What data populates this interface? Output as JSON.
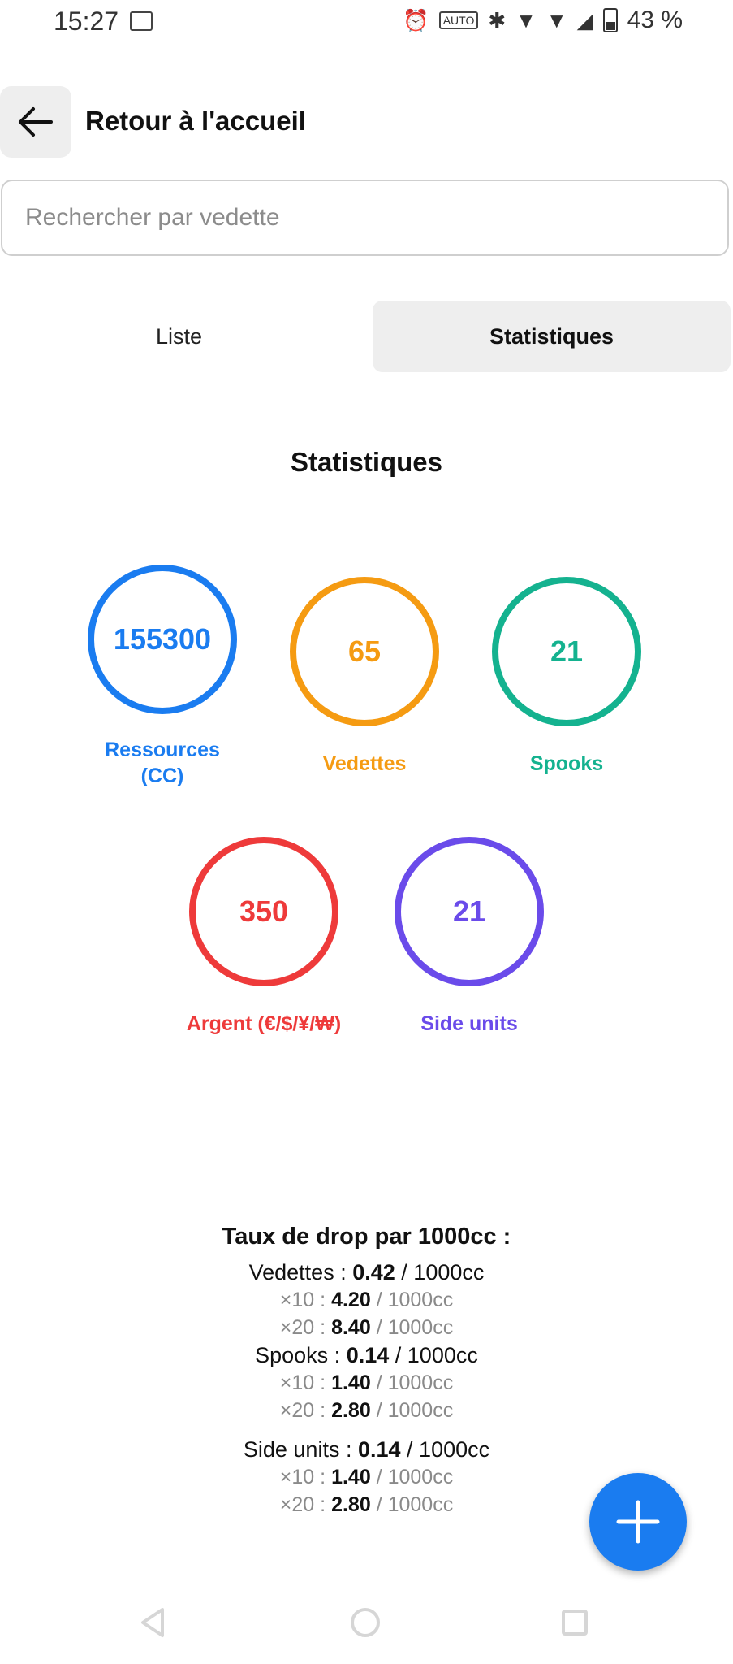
{
  "status_bar": {
    "time": "15:27",
    "battery": "43 %"
  },
  "header": {
    "title": "Retour à l'accueil"
  },
  "search": {
    "placeholder": "Rechercher par vedette"
  },
  "tabs": [
    {
      "label": "Liste",
      "active": false
    },
    {
      "label": "Statistiques",
      "active": true
    }
  ],
  "stats": {
    "title": "Statistiques",
    "items": [
      {
        "value": "155300",
        "label": "Ressources (CC)",
        "color": "#1a7cf0"
      },
      {
        "value": "65",
        "label": "Vedettes",
        "color": "#f59b12"
      },
      {
        "value": "21",
        "label": "Spooks",
        "color": "#14b28f"
      },
      {
        "value": "350",
        "label": "Argent (€/$/¥/₩)",
        "color": "#ee3a3a"
      },
      {
        "value": "21",
        "label": "Side units",
        "color": "#6a4bea"
      }
    ]
  },
  "drop_rates": {
    "title": "Taux de drop par 1000cc :",
    "unit": "/ 1000cc",
    "groups": [
      {
        "name": "Vedettes :",
        "rate": "0.42",
        "x10_label": "×10 :",
        "x10": "4.20",
        "x20_label": "×20 :",
        "x20": "8.40"
      },
      {
        "name": "Spooks :",
        "rate": "0.14",
        "x10_label": "×10 :",
        "x10": "1.40",
        "x20_label": "×20 :",
        "x20": "2.80"
      },
      {
        "name": "Side units :",
        "rate": "0.14",
        "x10_label": "×10 :",
        "x10": "1.40",
        "x20_label": "×20 :",
        "x20": "2.80"
      }
    ]
  },
  "icons": {
    "back": "arrow-left-icon",
    "fab": "plus-icon",
    "nav": [
      "back-triangle-icon",
      "home-circle-icon",
      "recents-square-icon"
    ]
  }
}
